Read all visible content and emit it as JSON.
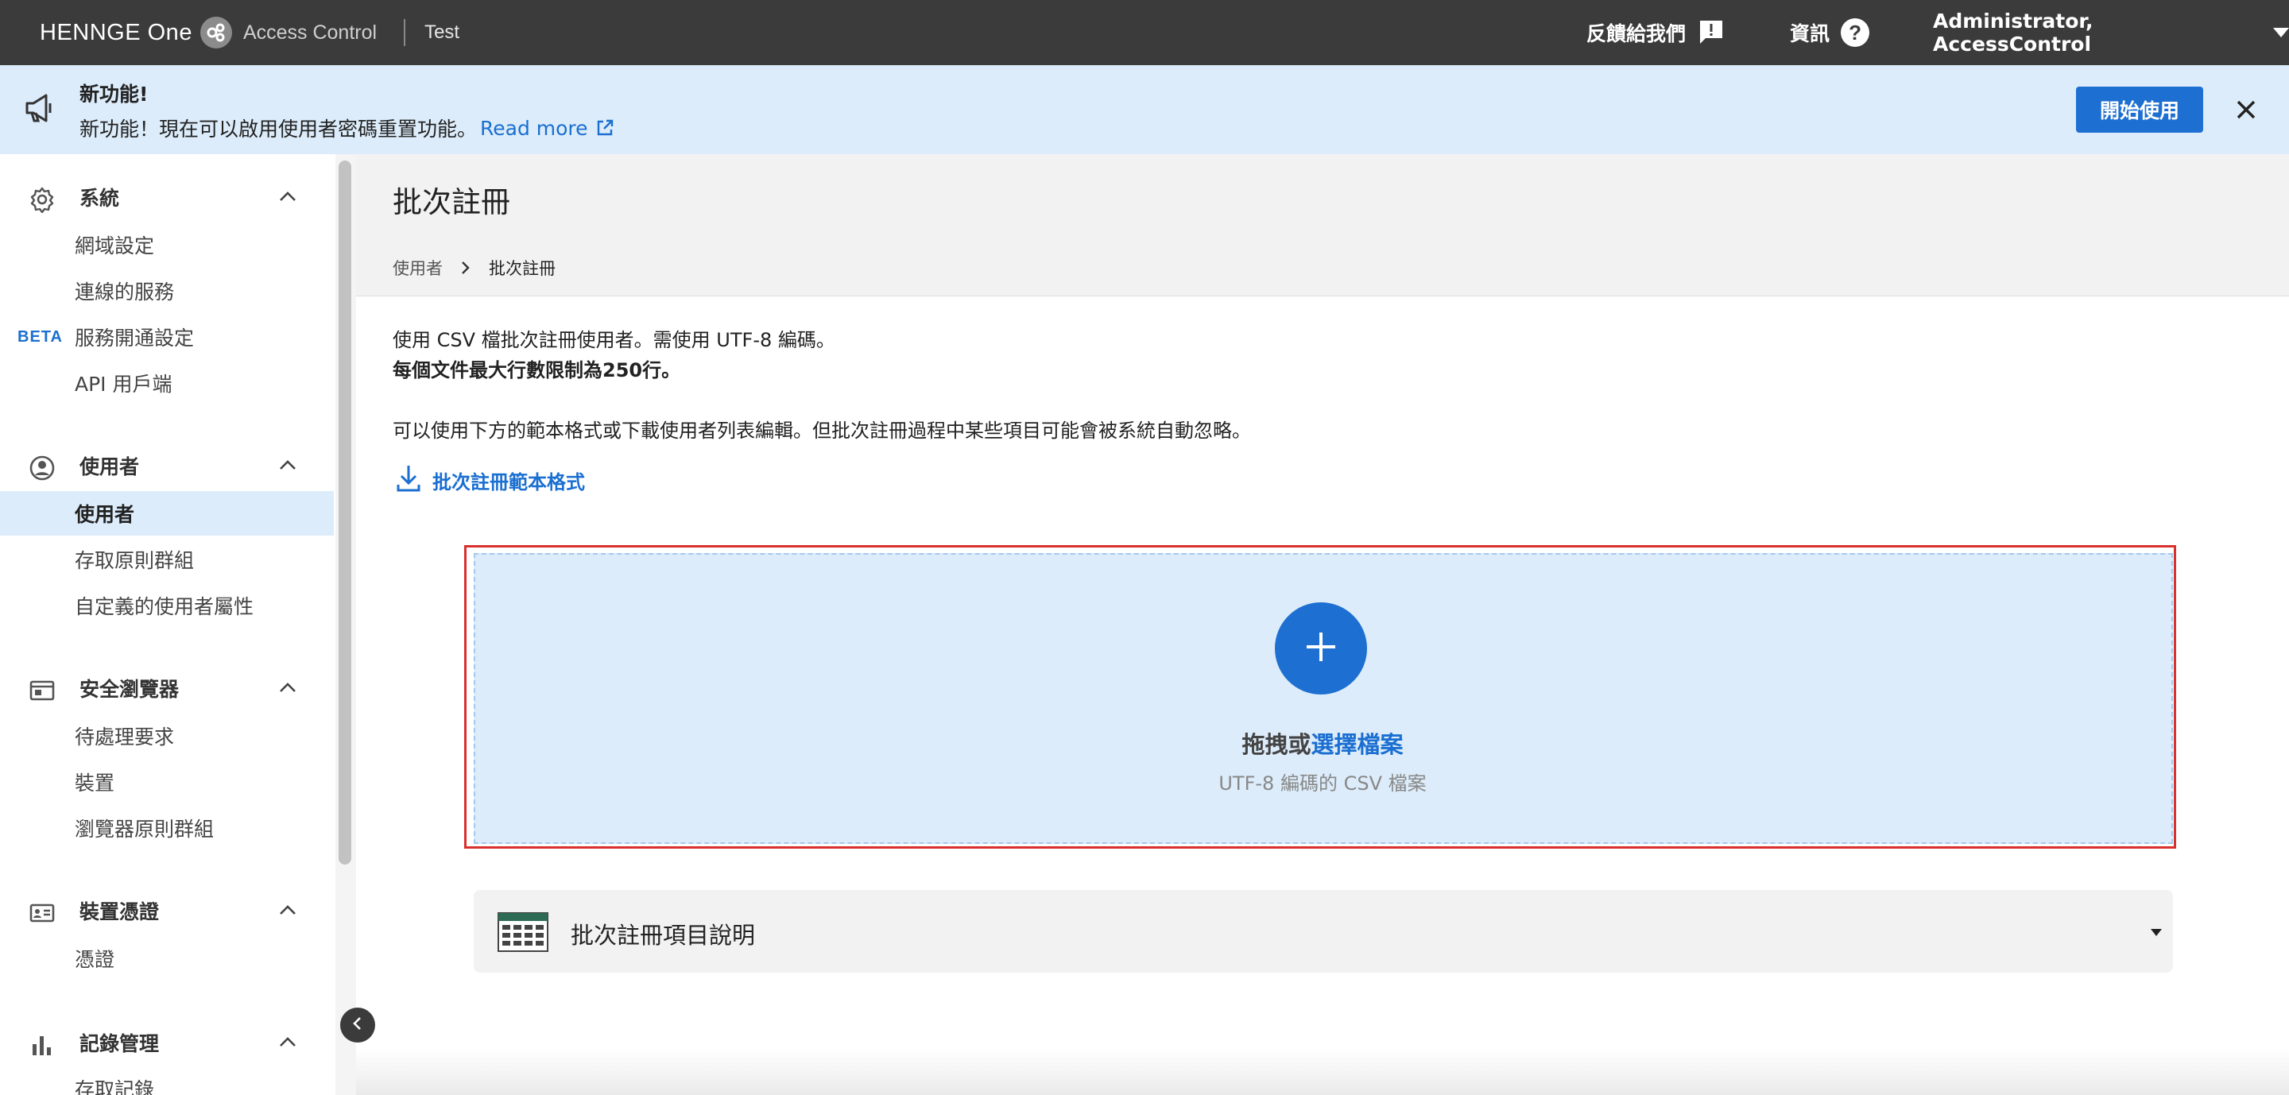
{
  "topbar": {
    "brand": "HENNGE One",
    "product": "Access Control",
    "tenant": "Test",
    "feedback": "反饋給我們",
    "info": "資訊",
    "help_glyph": "?",
    "user": "Administrator, AccessControl"
  },
  "announcement": {
    "title": "新功能!",
    "message": "新功能！現在可以啟用使用者密碼重置功能。",
    "link": "Read more",
    "start_button": "開始使用"
  },
  "sidebar": {
    "sections": [
      {
        "title": "系統",
        "icon": "gear-icon",
        "items": [
          "網域設定",
          "連線的服務",
          "服務開通設定",
          "API 用戶端"
        ]
      },
      {
        "title": "使用者",
        "icon": "user-circle-icon",
        "items": [
          "使用者",
          "存取原則群組",
          "自定義的使用者屬性"
        ]
      },
      {
        "title": "安全瀏覽器",
        "icon": "browser-window-icon",
        "items": [
          "待處理要求",
          "裝置",
          "瀏覽器原則群組"
        ]
      },
      {
        "title": "裝置憑證",
        "icon": "id-card-icon",
        "items": [
          "憑證"
        ]
      },
      {
        "title": "記錄管理",
        "icon": "bar-chart-icon",
        "items": [
          "存取記錄"
        ]
      }
    ],
    "beta_badge": "BETA",
    "active_item": "使用者"
  },
  "main": {
    "title": "批次註冊",
    "breadcrumb": [
      "使用者",
      "批次註冊"
    ],
    "desc1": "使用 CSV 檔批次註冊使用者。需使用 UTF-8 編碼。",
    "desc2": "每個文件最大行數限制為250行。",
    "desc3": "可以使用下方的範本格式或下載使用者列表編輯。但批次註冊過程中某些項目可能會被系統自動忽略。",
    "template_link": "批次註冊範本格式",
    "drop": {
      "prefix": "拖拽或",
      "link": "選擇檔案",
      "sub": "UTF-8 編碼的 CSV 檔案"
    },
    "accordion_title": "批次註冊項目說明"
  },
  "colors": {
    "topbar": "#3b3b3b",
    "accent": "#1d70d1",
    "banner": "#dcecfa",
    "highlight_border": "#d9302c"
  }
}
